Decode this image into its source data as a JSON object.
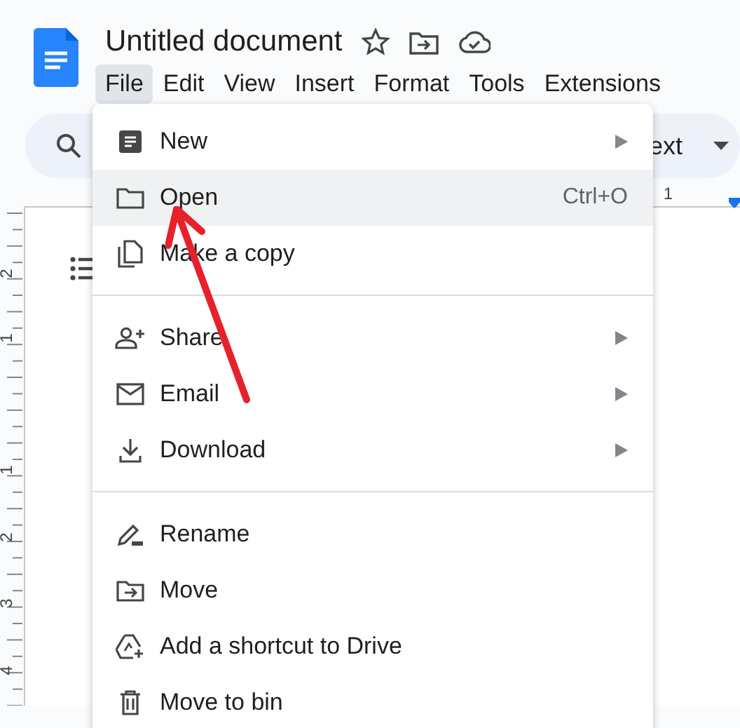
{
  "document": {
    "title": "Untitled document"
  },
  "menubar": [
    {
      "label": "File",
      "selected": true
    },
    {
      "label": "Edit",
      "selected": false
    },
    {
      "label": "View",
      "selected": false
    },
    {
      "label": "Insert",
      "selected": false
    },
    {
      "label": "Format",
      "selected": false
    },
    {
      "label": "Tools",
      "selected": false
    },
    {
      "label": "Extensions",
      "selected": false
    }
  ],
  "toolbar": {
    "style_dropdown": "ext"
  },
  "top_ruler": [
    "1"
  ],
  "left_ruler": [
    "2",
    "1",
    "1",
    "2",
    "3",
    "4"
  ],
  "file_menu": [
    {
      "kind": "item",
      "label": "New",
      "submenu": true,
      "selected": false
    },
    {
      "kind": "item",
      "label": "Open",
      "shortcut": "Ctrl+O",
      "submenu": false,
      "selected": true
    },
    {
      "kind": "item",
      "label": "Make a copy",
      "submenu": false,
      "selected": false
    },
    {
      "kind": "divider"
    },
    {
      "kind": "item",
      "label": "Share",
      "submenu": true,
      "selected": false
    },
    {
      "kind": "item",
      "label": "Email",
      "submenu": true,
      "selected": false
    },
    {
      "kind": "item",
      "label": "Download",
      "submenu": true,
      "selected": false
    },
    {
      "kind": "divider"
    },
    {
      "kind": "item",
      "label": "Rename",
      "submenu": false,
      "selected": false
    },
    {
      "kind": "item",
      "label": "Move",
      "submenu": false,
      "selected": false
    },
    {
      "kind": "item",
      "label": "Add a shortcut to Drive",
      "submenu": false,
      "selected": false
    },
    {
      "kind": "item",
      "label": "Move to bin",
      "submenu": false,
      "selected": false
    }
  ]
}
